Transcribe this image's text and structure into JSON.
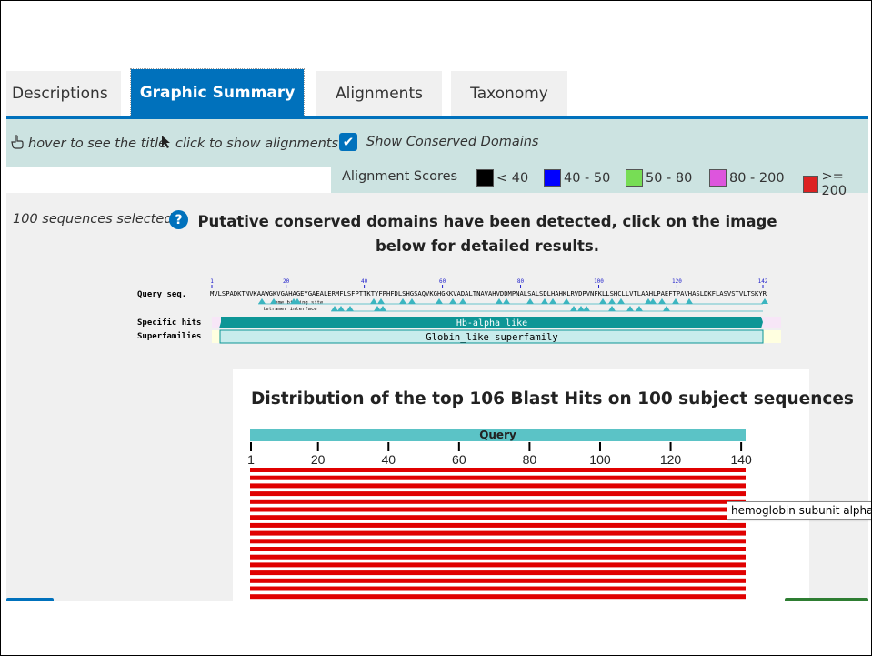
{
  "tabs": [
    {
      "label": "Descriptions",
      "active": false
    },
    {
      "label": "Graphic Summary",
      "active": true
    },
    {
      "label": "Alignments",
      "active": false
    },
    {
      "label": "Taxonomy",
      "active": false
    }
  ],
  "toolbar": {
    "hover_text": "hover to see the title",
    "click_text": "click to show alignments",
    "show_cdd_label": "Show Conserved Domains",
    "show_cdd_checked": true
  },
  "scores": {
    "label": "Alignment Scores",
    "items": [
      {
        "label": "< 40",
        "color": "#000000"
      },
      {
        "label": "40 - 50",
        "color": "#0000ff"
      },
      {
        "label": "50 - 80",
        "color": "#77dd55"
      },
      {
        "label": "80 - 200",
        "color": "#dd55dd"
      },
      {
        "label": ">= 200",
        "color": "#dd2222"
      }
    ]
  },
  "info": {
    "selected": "100 sequences selected",
    "message": "Putative conserved domains have been detected, click on the image below for detailed results."
  },
  "cdd": {
    "query_label": "Query seq.",
    "ticks": [
      "1",
      "20",
      "40",
      "60",
      "80",
      "100",
      "120",
      "142"
    ],
    "sequence": "MVLSPADKTNVKAAWGKVGAHAGEYGAEALERMFLSFPTTKTYFPHFDLSHGSAQVKGHGKKVADALTNAVAHVDDMPNALSALSDLHAHKLRVDPVNFKLLSHCLLVTLAAHLPAEFTPAVHASLDKFLASVSTVLTSKYR",
    "heme_label": "heme binding site",
    "tetramer_label": "tetramer interface",
    "specific_label": "Specific hits",
    "superfamilies_label": "Superfamilies",
    "specific_hit": "Hb-alpha_like",
    "superfamily": "Globin_like superfamily"
  },
  "distribution": {
    "title": "Distribution of the top 106 Blast Hits on 100 subject sequences",
    "query_label": "Query",
    "ticks": [
      "1",
      "20",
      "40",
      "60",
      "80",
      "100",
      "120",
      "140"
    ],
    "hit_color": "#e00000",
    "visible_hit_rows": 17
  },
  "tooltip": "hemoglobin subunit alpha"
}
